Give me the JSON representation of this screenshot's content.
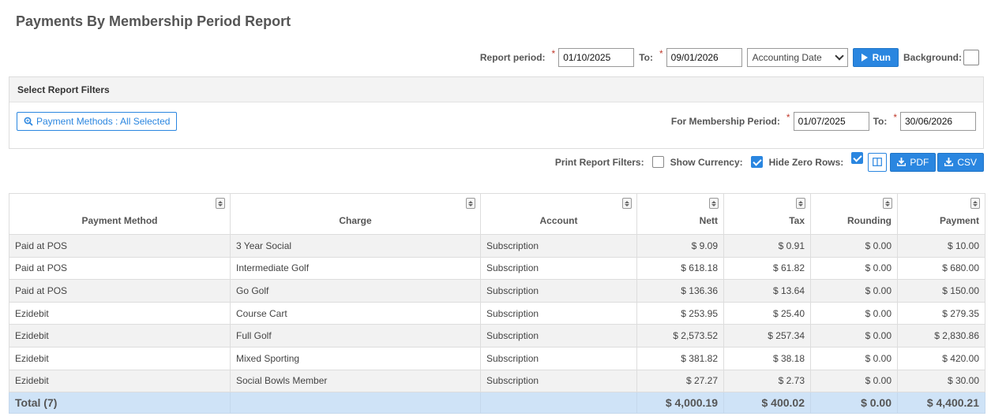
{
  "page": {
    "title": "Payments By Membership Period Report"
  },
  "period": {
    "label": "Report period:",
    "from": "01/10/2025",
    "to_label": "To:",
    "to": "09/01/2026",
    "date_type": "Accounting Date",
    "run_label": "Run",
    "background_label": "Background:"
  },
  "filters": {
    "header": "Select Report Filters",
    "payment_methods_label": "Payment Methods : All Selected",
    "membership_label": "For Membership Period:",
    "membership_from": "01/07/2025",
    "membership_to_label": "To:",
    "membership_to": "30/06/2026"
  },
  "options": {
    "print_filters_label": "Print Report Filters:",
    "show_currency_label": "Show Currency:",
    "hide_zero_label": "Hide Zero Rows:",
    "pdf_label": "PDF",
    "csv_label": "CSV"
  },
  "table": {
    "headers": [
      "Payment Method",
      "Charge",
      "Account",
      "Nett",
      "Tax",
      "Rounding",
      "Payment"
    ],
    "rows": [
      [
        "Paid at POS",
        "3 Year Social",
        "Subscription",
        "$ 9.09",
        "$ 0.91",
        "$ 0.00",
        "$ 10.00"
      ],
      [
        "Paid at POS",
        "Intermediate Golf",
        "Subscription",
        "$ 618.18",
        "$ 61.82",
        "$ 0.00",
        "$ 680.00"
      ],
      [
        "Paid at POS",
        "Go Golf",
        "Subscription",
        "$ 136.36",
        "$ 13.64",
        "$ 0.00",
        "$ 150.00"
      ],
      [
        "Ezidebit",
        "Course Cart",
        "Subscription",
        "$ 253.95",
        "$ 25.40",
        "$ 0.00",
        "$ 279.35"
      ],
      [
        "Ezidebit",
        "Full Golf",
        "Subscription",
        "$ 2,573.52",
        "$ 257.34",
        "$ 0.00",
        "$ 2,830.86"
      ],
      [
        "Ezidebit",
        "Mixed Sporting",
        "Subscription",
        "$ 381.82",
        "$ 38.18",
        "$ 0.00",
        "$ 420.00"
      ],
      [
        "Ezidebit",
        "Social Bowls Member",
        "Subscription",
        "$ 27.27",
        "$ 2.73",
        "$ 0.00",
        "$ 30.00"
      ]
    ],
    "total": {
      "label": "Total (7)",
      "nett": "$ 4,000.19",
      "tax": "$ 400.02",
      "rounding": "$ 0.00",
      "payment": "$ 4,400.21"
    }
  }
}
